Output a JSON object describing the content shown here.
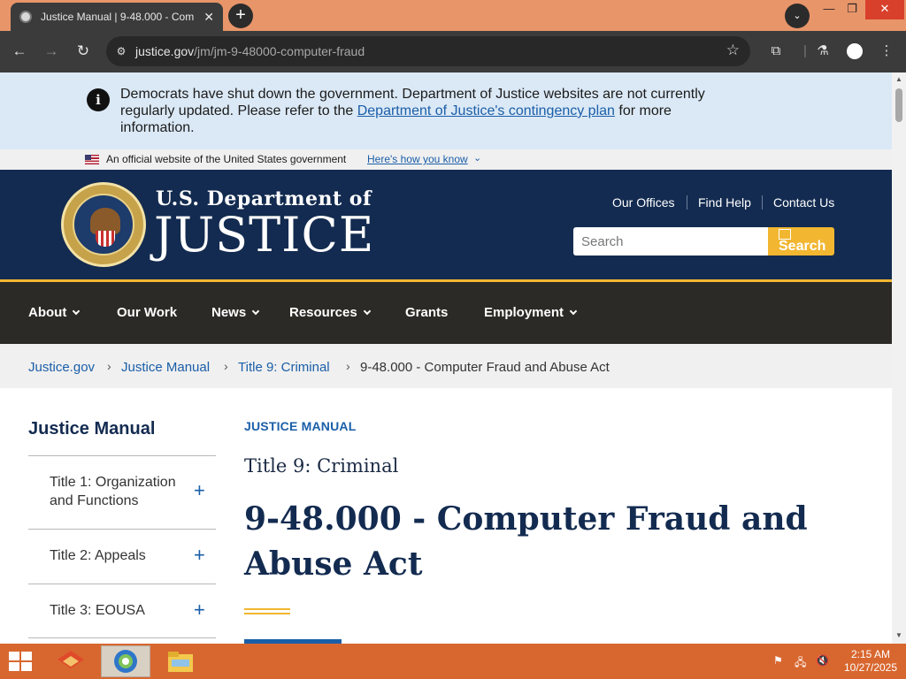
{
  "browser": {
    "tab_title": "Justice Manual | 9-48.000 - Com",
    "tab_close": "✕",
    "url_host": "justice.gov",
    "url_path": "/jm/jm-9-48000-computer-fraud"
  },
  "alert": {
    "text_before": "Democrats have shut down the government. Department of Justice websites are not currently regularly updated. Please refer to the ",
    "link": "Department of Justice's contingency plan",
    "text_after": " for more information."
  },
  "gov_banner": {
    "text": "An official website of the United States government",
    "link": "Here's how you know"
  },
  "header": {
    "brand_small": "U.S. Department of",
    "brand_big": "JUSTICE",
    "utility_links": [
      "Our Offices",
      "Find Help",
      "Contact Us"
    ],
    "search_placeholder": "Search",
    "search_button": "Search"
  },
  "nav": {
    "items": [
      "About",
      "Our Work",
      "News",
      "Resources",
      "Grants",
      "Employment"
    ]
  },
  "breadcrumb": {
    "items": [
      "Justice.gov",
      "Justice Manual",
      "Title 9: Criminal",
      "9-48.000 - Computer Fraud and Abuse Act"
    ]
  },
  "sidebar": {
    "title": "Justice Manual",
    "items": [
      "Title 1: Organization and Functions",
      "Title 2: Appeals",
      "Title 3: EOUSA"
    ]
  },
  "content": {
    "eyebrow": "JUSTICE MANUAL",
    "subhead": "Title 9: Criminal",
    "title": "9-48.000 - Computer Fraud and Abuse Act"
  },
  "taskbar": {
    "time": "2:15 AM",
    "date": "10/27/2025"
  },
  "colors": {
    "navy": "#132b50",
    "gold": "#f2b631",
    "link_blue": "#1a5ea8",
    "nav_bg": "#2b2a26",
    "alert_bg": "#dbe9f6",
    "taskbar": "#d8672f",
    "tabbar": "#e8956a"
  },
  "icons": [
    "info-icon",
    "star-icon",
    "extensions-icon",
    "labs-icon",
    "profile-icon",
    "menu-icon",
    "plus-icon",
    "chevron-down-icon",
    "windows-start-icon",
    "flag-icon",
    "network-icon",
    "mute-icon"
  ]
}
